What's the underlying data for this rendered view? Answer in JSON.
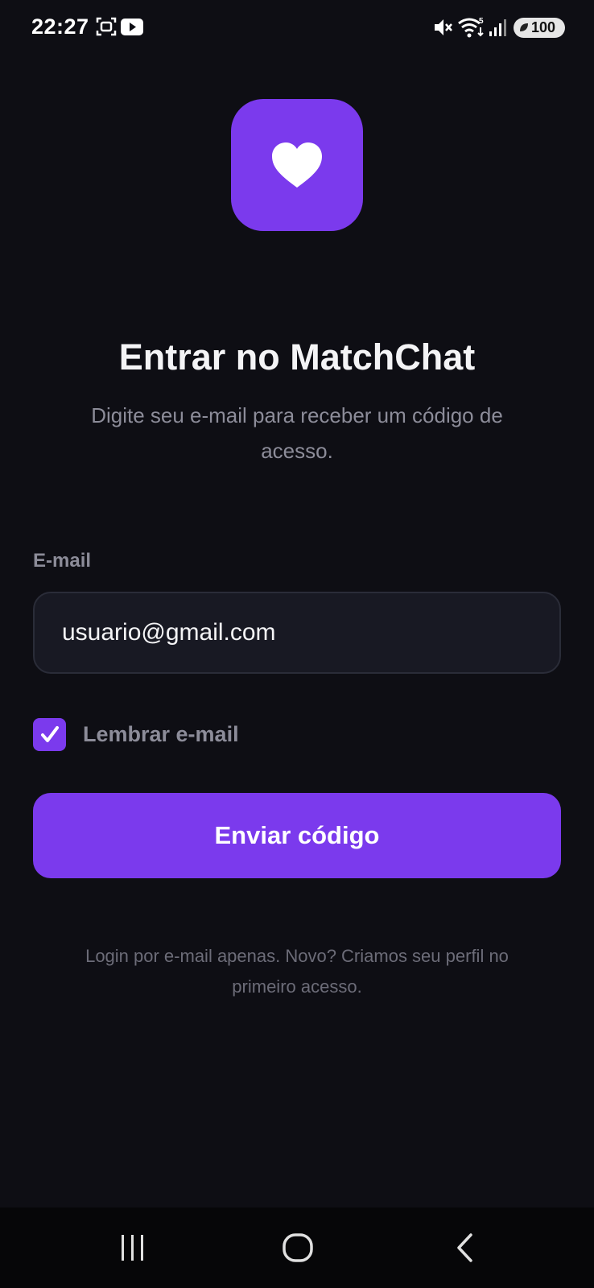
{
  "status_bar": {
    "time": "22:27",
    "battery": "100",
    "icons": [
      "screenshot-icon",
      "youtube-icon",
      "mute-icon",
      "wifi-icon",
      "signal-icon",
      "battery-icon"
    ]
  },
  "app": {
    "icon": "heart-icon",
    "accent_color": "#7b3aed",
    "background_color": "#0e0e14"
  },
  "login": {
    "title": "Entrar no MatchChat",
    "subtitle": "Digite seu e-mail para receber um código de acesso.",
    "email_label": "E-mail",
    "email_value": "usuario@gmail.com",
    "remember_checked": true,
    "remember_label": "Lembrar e-mail",
    "submit_label": "Enviar código",
    "footer_note": "Login por e-mail apenas. Novo? Criamos seu perfil no primeiro acesso."
  },
  "nav_bar": {
    "buttons": [
      "recent-apps-icon",
      "home-icon",
      "back-icon"
    ]
  }
}
